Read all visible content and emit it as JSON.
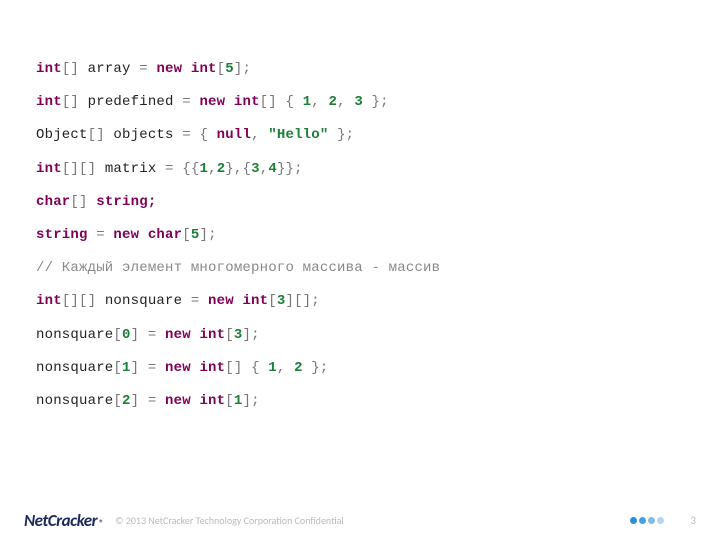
{
  "code": {
    "l1": {
      "t1": "int",
      "t2": "[] ",
      "t3": "array ",
      "t4": "=",
      "t5": " new int",
      "t6": "[",
      "t7": "5",
      "t8": "];"
    },
    "l2": {
      "t1": "int",
      "t2": "[] ",
      "t3": "predefined ",
      "t4": "=",
      "t5": " new int",
      "t6": "[] { ",
      "t7": "1",
      "t8": ", ",
      "t9": "2",
      "t10": ", ",
      "t11": "3",
      "t12": " };"
    },
    "l3": {
      "t1": "Object",
      "t2": "[] ",
      "t3": "objects ",
      "t4": "=",
      "t5": " { ",
      "t6": "null",
      "t7": ", ",
      "t8": "\"Hello\"",
      "t9": " };"
    },
    "l4": {
      "t1": "int",
      "t2": "[][] ",
      "t3": "matrix ",
      "t4": "=",
      "t5": " {{",
      "t6": "1",
      "t7": ",",
      "t8": "2",
      "t9": "},{",
      "t10": "3",
      "t11": ",",
      "t12": "4",
      "t13": "}};"
    },
    "l5": {
      "t1": "char",
      "t2": "[] ",
      "t3": "string;"
    },
    "l6": {
      "t1": "string ",
      "t2": "=",
      "t3": " new char",
      "t4": "[",
      "t5": "5",
      "t6": "];"
    },
    "l7": {
      "t1": "// Каждый элемент многомерного массива - массив"
    },
    "l8": {
      "t1": "int",
      "t2": "[][] ",
      "t3": "nonsquare ",
      "t4": "=",
      "t5": " new int",
      "t6": "[",
      "t7": "3",
      "t8": "][];"
    },
    "l9": {
      "t1": "nonsquare",
      "t2": "[",
      "t3": "0",
      "t4": "] ",
      "t5": "=",
      "t6": " new int",
      "t7": "[",
      "t8": "3",
      "t9": "];"
    },
    "l10": {
      "t1": "nonsquare",
      "t2": "[",
      "t3": "1",
      "t4": "] ",
      "t5": "=",
      "t6": " new int",
      "t7": "[] { ",
      "t8": "1",
      "t9": ", ",
      "t10": "2",
      "t11": " };"
    },
    "l11": {
      "t1": "nonsquare",
      "t2": "[",
      "t3": "2",
      "t4": "] ",
      "t5": "=",
      "t6": " new int",
      "t7": "[",
      "t8": "1",
      "t9": "];"
    }
  },
  "footer": {
    "logo_net": "Net",
    "logo_crack": "Cracker",
    "logo_reg": "®",
    "copyright": "© 2013 NetCracker Technology Corporation Confidential",
    "page": "3"
  }
}
